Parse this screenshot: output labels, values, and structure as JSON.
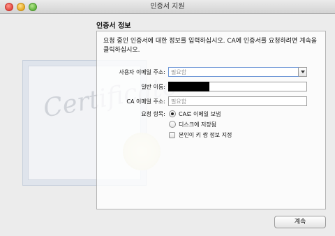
{
  "window": {
    "title": "인증서 지원"
  },
  "cert_art": {
    "word": "Certificate"
  },
  "section": {
    "title": "인증서 정보"
  },
  "intro_text": "요청 중인 인증서에 대한 정보를 입력하십시오. CA에 인증서를 요청하려면 계속을 클릭하십시오.",
  "form": {
    "email": {
      "label": "사용자 이메일 주소:",
      "placeholder": "필요함",
      "value": ""
    },
    "common_name": {
      "label": "일반 이름:",
      "value": ""
    },
    "ca_email": {
      "label": "CA 이메일 주소:",
      "placeholder": "필요함",
      "value": ""
    },
    "request_label": "요청 항목:",
    "options": [
      {
        "label": "CA로 이메일 보냄",
        "selected": true
      },
      {
        "label": "디스크에 저장됨",
        "selected": false
      }
    ],
    "keypair_checkbox": {
      "label": "본인이 키 쌍 정보 지정",
      "checked": false
    }
  },
  "buttons": {
    "continue_label": "계속"
  }
}
